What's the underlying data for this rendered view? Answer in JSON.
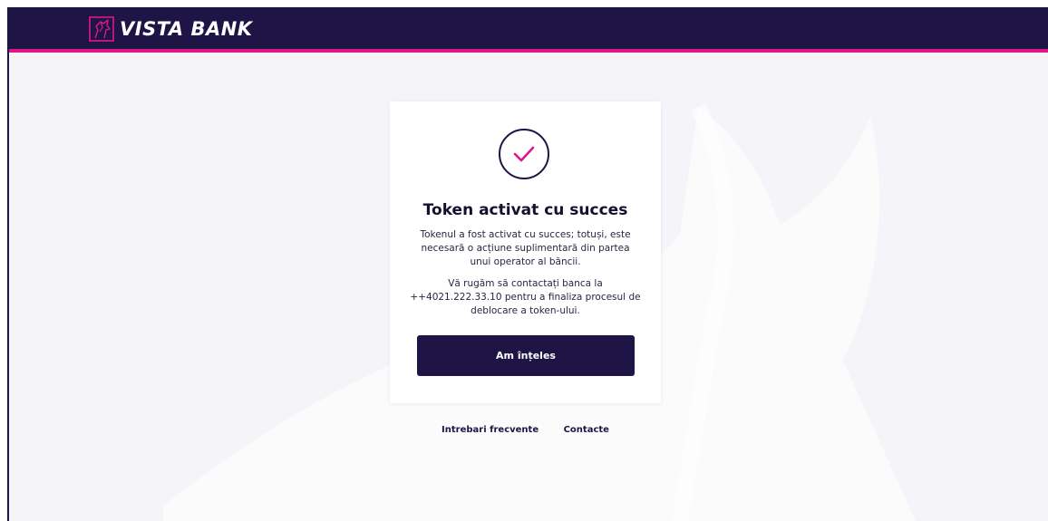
{
  "brand": {
    "name": "VISTA BANK",
    "primary_color": "#1e1446",
    "accent_color": "#e0168a"
  },
  "card": {
    "icon": "checkmark-circle-icon",
    "title": "Token activat cu succes",
    "message_1": "Tokenul a fost activat cu succes; totuși, este necesară o acțiune suplimentară din partea unui operator al băncii.",
    "message_2": "Vă rugăm să contactați banca la ++4021.222.33.10 pentru a finaliza procesul de deblocare a token-ului.",
    "button_label": "Am înțeles"
  },
  "footer": {
    "links": [
      "Intrebari frecvente",
      "Contacte"
    ]
  }
}
